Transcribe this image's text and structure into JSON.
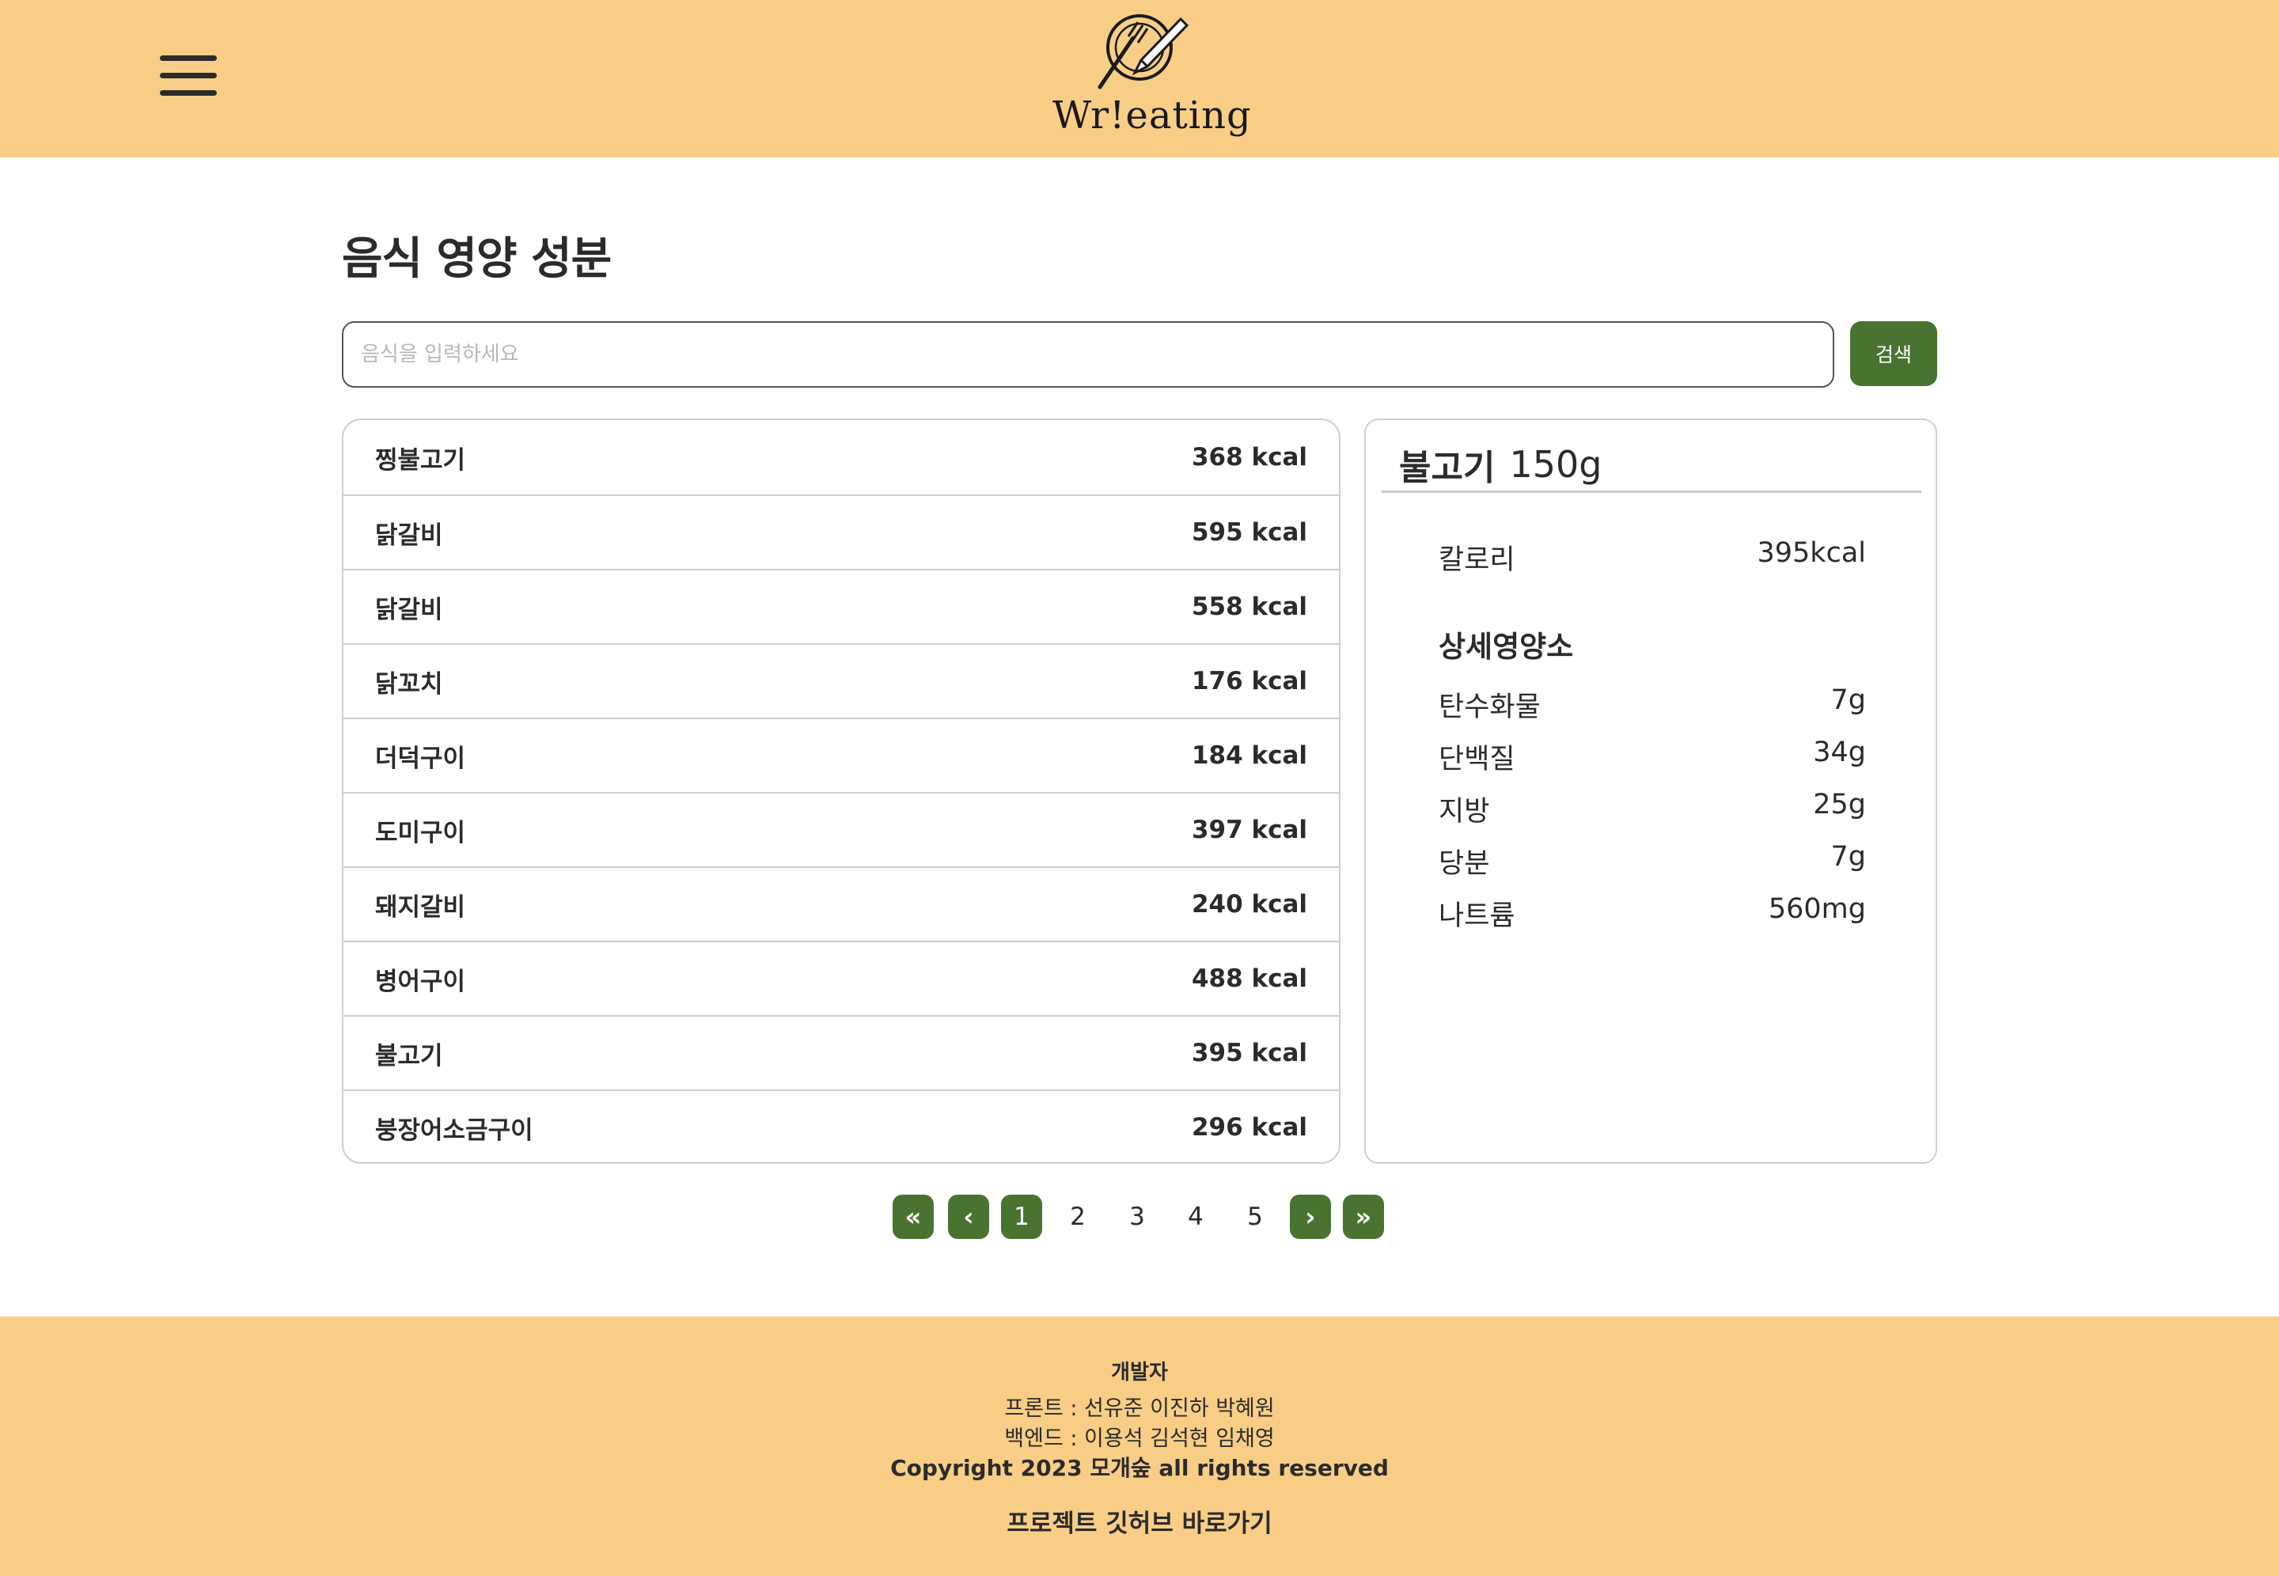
{
  "header": {
    "logo_text": "Wr!eating",
    "menu_icon": "hamburger-menu-icon",
    "logo_icon": "plate-fork-pencil-icon"
  },
  "page": {
    "title": "음식 영양 성분"
  },
  "search": {
    "placeholder": "음식을 입력하세요",
    "value": "",
    "button_label": "검색"
  },
  "food_list": [
    {
      "name": "찡불고기",
      "kcal": "368 kcal"
    },
    {
      "name": "닭갈비",
      "kcal": "595 kcal"
    },
    {
      "name": "닭갈비",
      "kcal": "558 kcal"
    },
    {
      "name": "닭꼬치",
      "kcal": "176 kcal"
    },
    {
      "name": "더덕구이",
      "kcal": "184 kcal"
    },
    {
      "name": "도미구이",
      "kcal": "397 kcal"
    },
    {
      "name": "돼지갈비",
      "kcal": "240 kcal"
    },
    {
      "name": "병어구이",
      "kcal": "488 kcal"
    },
    {
      "name": "불고기",
      "kcal": "395 kcal"
    },
    {
      "name": "붕장어소금구이",
      "kcal": "296 kcal"
    }
  ],
  "detail": {
    "food_name": "불고기",
    "amount": "150g",
    "calorie_label": "칼로리",
    "calorie_value": "395kcal",
    "section_title": "상세영양소",
    "nutrients": [
      {
        "label": "탄수화물",
        "value": "7g"
      },
      {
        "label": "단백질",
        "value": "34g"
      },
      {
        "label": "지방",
        "value": "25g"
      },
      {
        "label": "당분",
        "value": "7g"
      },
      {
        "label": "나트륨",
        "value": "560mg"
      }
    ]
  },
  "pagination": {
    "first": "«",
    "prev": "‹",
    "next": "›",
    "last": "»",
    "pages": [
      "1",
      "2",
      "3",
      "4",
      "5"
    ],
    "current": "1"
  },
  "footer": {
    "heading": "개발자",
    "front": "프론트 : 선유준 이진하 박혜원",
    "back": "백엔드 : 이용석 김석현 임채영",
    "copyright": "Copyright 2023 모개숲 all rights reserved",
    "github_link": "프로젝트 깃허브 바로가기"
  },
  "colors": {
    "header_bg": "#f8ce87",
    "accent_green": "#4a7332",
    "text": "#2b2b2b",
    "border": "#cfcfcf"
  }
}
